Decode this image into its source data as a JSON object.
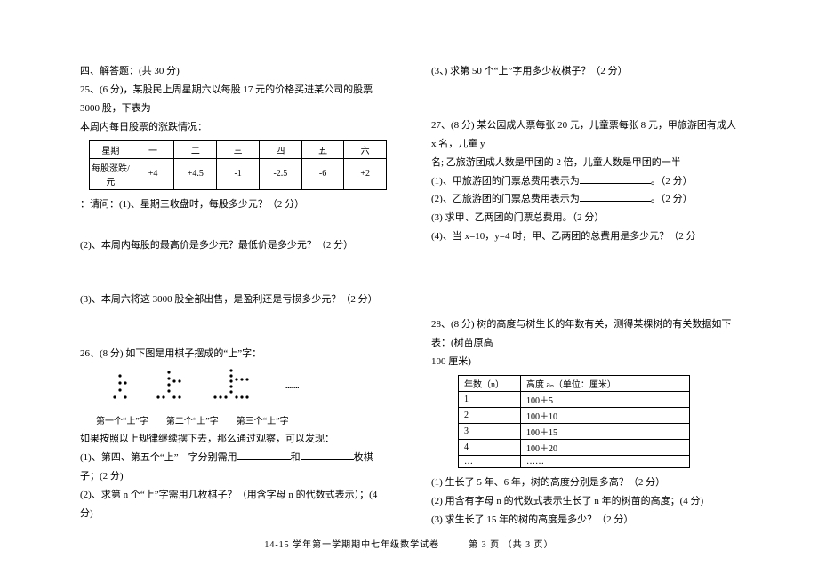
{
  "left": {
    "section4_title": "四、解答题：(共 30 分)",
    "q25_intro1": "25、(6 分)，某股民上周星期六以每股 17 元的价格买进某公司的股票 3000 股，下表为",
    "q25_intro2": "本周内每日股票的涨跌情况：",
    "stock_table": {
      "header": [
        "星期",
        "一",
        "二",
        "三",
        "四",
        "五",
        "六"
      ],
      "row": [
        "每股涨跌/元",
        "+4",
        "+4.5",
        "-1",
        "-2.5",
        "-6",
        "+2"
      ]
    },
    "q25_sub1": "：请问：(1)、星期三收盘时，每股多少元？（2 分）",
    "q25_sub2": "(2)、本周内每股的最高价是多少元？最低价是多少元？（2 分）",
    "q25_sub3": "(3)、本周六将这 3000 股全部出售，是盈利还是亏损多少元？（2 分）",
    "q26_intro": "26、(8 分) 如下图是用棋子摆成的“上”字：",
    "pattern_labels": "第一个“上”字　　第二个“上”字　　第三个“上”字",
    "pattern_trail": "………",
    "q26_rule": "如果按照以上规律继续摆下去，那么通过观察，可以发现：",
    "q26_sub1a": "(1)、第四、第五个“上”　字分别需用",
    "q26_sub1b": "和",
    "q26_sub1c": "枚棋子；(2 分)",
    "q26_sub2": "(2)、求第 n 个“上”字需用几枚棋子？（用含字母 n 的代数式表示）；(4 分)"
  },
  "right": {
    "q26_sub3": "(3、) 求第 50 个“上”字用多少枚棋子？（2 分）",
    "q27_intro1": "27、(8 分) 某公园成人票每张 20 元，儿童票每张 8 元，甲旅游团有成人 x 名，儿童 y",
    "q27_intro2": "名; 乙旅游团成人数是甲团的 2 倍，儿童人数是甲团的一半",
    "q27_sub1a": "(1)、甲旅游团的门票总费用表示为",
    "q27_sub1b": "。（2 分）",
    "q27_sub2a": "(2)、乙旅游团的门票总费用表示为",
    "q27_sub2b": "。（2 分）",
    "q27_sub3": "(3) 求甲、乙两团的门票总费用。（2 分）",
    "q27_sub4": "(4)、当 x=10，y=4 时，甲、乙两团的总费用是多少元？（2 分",
    "q28_intro1": "28、(8 分) 树的高度与树生长的年数有关，测得某棵树的有关数据如下表：(树苗原高",
    "q28_intro2": "100 厘米)",
    "tree_table": {
      "header": [
        "年数（n）",
        "高度 aₙ（单位：厘米）"
      ],
      "rows": [
        [
          "1",
          "100＋5"
        ],
        [
          "2",
          "100＋10"
        ],
        [
          "3",
          "100＋15"
        ],
        [
          "4",
          "100＋20"
        ],
        [
          "…",
          "……"
        ]
      ]
    },
    "q28_sub1": "(1) 生长了 5 年、6 年，树的高度分别是多高？（2 分）",
    "q28_sub2": "(2) 用含有字母 n 的代数式表示生长了 n 年的树苗的高度；(4 分)",
    "q28_sub3": "(3) 求生长了 15 年的树的高度是多少？（2 分）"
  },
  "footer": "14-15 学年第一学期期中七年级数学试卷　　　第 3 页 （共 3 页）"
}
